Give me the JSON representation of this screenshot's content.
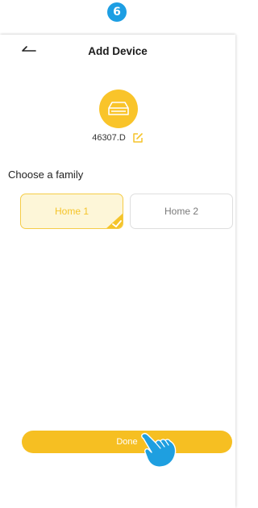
{
  "step": {
    "number": "6"
  },
  "header": {
    "title": "Add Device"
  },
  "device": {
    "name": "46307.D",
    "icon": "nvr-recorder-icon"
  },
  "family": {
    "label": "Choose a family",
    "options": [
      {
        "name": "Home 1",
        "selected": true
      },
      {
        "name": "Home 2",
        "selected": false
      }
    ]
  },
  "actions": {
    "done_label": "Done"
  },
  "colors": {
    "accent": "#f6bf22",
    "step_badge": "#1d9ee3",
    "selected_bg": "#fdf6d8",
    "pointer_hand": "#1e9fe0"
  }
}
